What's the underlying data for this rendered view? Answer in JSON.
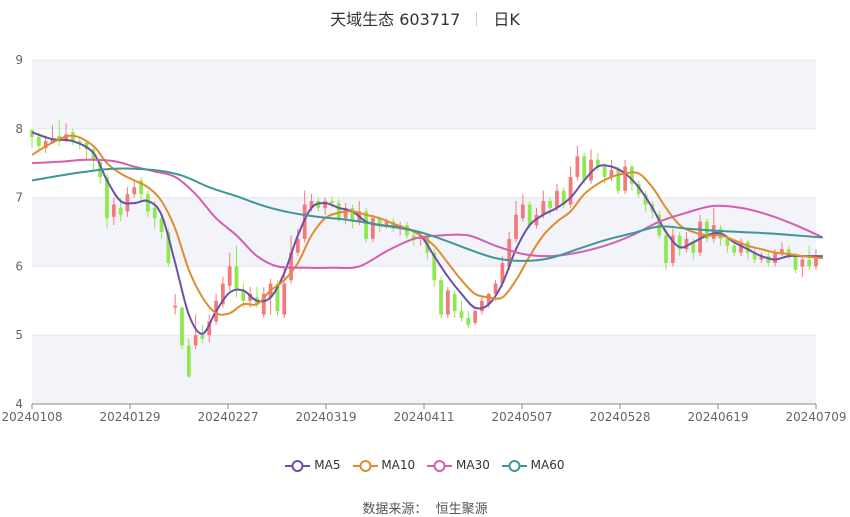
{
  "title": {
    "stock": "天域生态 603717",
    "period": "日K"
  },
  "source": {
    "label": "数据来源：",
    "value": "恒生聚源"
  },
  "colors": {
    "up": "#f47a7a",
    "down": "#8ee84e",
    "ma5": "#6e4fa8",
    "ma10": "#e08c32",
    "ma30": "#d45eb0",
    "ma60": "#3e9696",
    "band": "#f2f4fa",
    "grid": "#e6e8ef",
    "axis": "#8a8a8a"
  },
  "chart_data": {
    "type": "candlestick",
    "ylim": [
      4,
      9
    ],
    "yticks": [
      "4",
      "5",
      "6",
      "7",
      "8",
      "9"
    ],
    "xticks": [
      "20240108",
      "20240129",
      "20240227",
      "20240319",
      "20240411",
      "20240507",
      "20240528",
      "20240619",
      "20240709"
    ],
    "legend": [
      "MA5",
      "MA10",
      "MA30",
      "MA60"
    ],
    "legend_position": "bottom",
    "candles": [
      [
        7.98,
        7.88,
        8.0,
        7.72
      ],
      [
        7.88,
        7.75,
        7.95,
        7.68
      ],
      [
        7.72,
        7.82,
        7.9,
        7.65
      ],
      [
        7.8,
        7.86,
        8.05,
        7.78
      ],
      [
        7.9,
        7.82,
        8.12,
        7.75
      ],
      [
        7.84,
        7.92,
        8.08,
        7.8
      ],
      [
        7.95,
        7.82,
        8.0,
        7.76
      ],
      [
        7.82,
        7.78,
        7.88,
        7.7
      ],
      [
        7.8,
        7.7,
        7.84,
        7.55
      ],
      [
        7.7,
        7.56,
        7.74,
        7.4
      ],
      [
        7.52,
        7.3,
        7.56,
        7.2
      ],
      [
        7.3,
        6.7,
        7.34,
        6.55
      ],
      [
        6.72,
        6.9,
        7.0,
        6.6
      ],
      [
        6.85,
        6.75,
        7.0,
        6.65
      ],
      [
        6.8,
        7.05,
        7.15,
        6.72
      ],
      [
        7.05,
        7.15,
        7.25,
        7.0
      ],
      [
        7.25,
        7.05,
        7.3,
        6.95
      ],
      [
        7.05,
        6.8,
        7.1,
        6.72
      ],
      [
        6.85,
        6.7,
        6.95,
        6.55
      ],
      [
        6.7,
        6.5,
        6.75,
        6.4
      ],
      [
        6.5,
        6.05,
        6.55,
        6.0
      ],
      [
        5.4,
        5.43,
        5.6,
        5.3
      ],
      [
        5.4,
        4.85,
        5.42,
        4.8
      ],
      [
        4.85,
        4.4,
        4.95,
        4.38
      ],
      [
        4.85,
        5.0,
        5.3,
        4.8
      ],
      [
        5.0,
        4.95,
        5.15,
        4.88
      ],
      [
        5.0,
        5.2,
        5.3,
        4.9
      ],
      [
        5.2,
        5.5,
        5.6,
        5.15
      ],
      [
        5.45,
        5.75,
        5.85,
        5.4
      ],
      [
        5.72,
        6.0,
        6.2,
        5.65
      ],
      [
        6.0,
        5.65,
        6.3,
        5.55
      ],
      [
        5.65,
        5.5,
        5.75,
        5.4
      ],
      [
        5.5,
        5.6,
        5.7,
        5.4
      ],
      [
        5.55,
        5.45,
        5.7,
        5.4
      ],
      [
        5.3,
        5.6,
        5.7,
        5.25
      ],
      [
        5.55,
        5.75,
        5.82,
        5.3
      ],
      [
        5.75,
        5.35,
        5.8,
        5.28
      ],
      [
        5.3,
        5.75,
        6.0,
        5.25
      ],
      [
        5.8,
        6.2,
        6.45,
        5.75
      ],
      [
        6.2,
        6.4,
        6.55,
        6.15
      ],
      [
        6.4,
        6.9,
        7.1,
        6.35
      ],
      [
        6.85,
        6.95,
        7.05,
        6.8
      ],
      [
        6.95,
        6.85,
        7.0,
        6.8
      ],
      [
        6.85,
        6.95,
        7.0,
        6.75
      ],
      [
        6.95,
        6.92,
        7.02,
        6.85
      ],
      [
        6.92,
        6.7,
        6.98,
        6.65
      ],
      [
        6.7,
        6.85,
        6.92,
        6.62
      ],
      [
        6.85,
        6.65,
        6.9,
        6.55
      ],
      [
        6.65,
        6.8,
        6.95,
        6.6
      ],
      [
        6.8,
        6.4,
        6.85,
        6.35
      ],
      [
        6.4,
        6.7,
        6.75,
        6.35
      ],
      [
        6.7,
        6.6,
        6.72,
        6.5
      ],
      [
        6.6,
        6.65,
        6.7,
        6.55
      ],
      [
        6.65,
        6.55,
        6.7,
        6.5
      ],
      [
        6.55,
        6.6,
        6.65,
        6.45
      ],
      [
        6.6,
        6.45,
        6.65,
        6.4
      ],
      [
        6.45,
        6.4,
        6.5,
        6.3
      ],
      [
        6.4,
        6.45,
        6.5,
        6.3
      ],
      [
        6.45,
        6.2,
        6.48,
        6.1
      ],
      [
        6.2,
        5.8,
        6.25,
        5.7
      ],
      [
        5.8,
        5.3,
        5.85,
        5.25
      ],
      [
        5.3,
        5.65,
        5.7,
        5.25
      ],
      [
        5.6,
        5.35,
        5.65,
        5.25
      ],
      [
        5.35,
        5.25,
        5.5,
        5.2
      ],
      [
        5.25,
        5.15,
        5.35,
        5.1
      ],
      [
        5.18,
        5.35,
        5.4,
        5.15
      ],
      [
        5.35,
        5.5,
        5.55,
        5.3
      ],
      [
        5.45,
        5.6,
        5.62,
        5.4
      ],
      [
        5.6,
        5.75,
        5.8,
        5.5
      ],
      [
        5.75,
        6.05,
        6.15,
        5.7
      ],
      [
        6.0,
        6.4,
        6.5,
        5.95
      ],
      [
        6.4,
        6.75,
        6.95,
        6.35
      ],
      [
        6.7,
        6.9,
        7.05,
        6.65
      ],
      [
        6.9,
        6.6,
        6.95,
        6.55
      ],
      [
        6.6,
        6.75,
        6.85,
        6.55
      ],
      [
        6.75,
        6.95,
        7.1,
        6.7
      ],
      [
        6.95,
        6.85,
        7.0,
        6.75
      ],
      [
        6.85,
        7.1,
        7.2,
        6.8
      ],
      [
        7.1,
        6.9,
        7.15,
        6.85
      ],
      [
        6.9,
        7.3,
        7.45,
        6.85
      ],
      [
        7.3,
        7.6,
        7.75,
        7.25
      ],
      [
        7.6,
        7.25,
        7.65,
        7.2
      ],
      [
        7.25,
        7.55,
        7.7,
        7.2
      ],
      [
        7.55,
        7.45,
        7.65,
        7.4
      ],
      [
        7.45,
        7.3,
        7.5,
        7.2
      ],
      [
        7.3,
        7.4,
        7.55,
        7.25
      ],
      [
        7.4,
        7.1,
        7.45,
        7.05
      ],
      [
        7.1,
        7.45,
        7.55,
        7.05
      ],
      [
        7.45,
        7.2,
        7.48,
        7.1
      ],
      [
        7.2,
        7.05,
        7.25,
        7.0
      ],
      [
        7.05,
        6.9,
        7.1,
        6.8
      ],
      [
        6.9,
        6.8,
        6.95,
        6.7
      ],
      [
        6.75,
        6.45,
        6.8,
        6.4
      ],
      [
        6.45,
        6.05,
        6.55,
        5.95
      ],
      [
        6.05,
        6.45,
        6.55,
        6.0
      ],
      [
        6.45,
        6.25,
        6.5,
        6.15
      ],
      [
        6.25,
        6.4,
        6.5,
        6.2
      ],
      [
        6.35,
        6.2,
        6.4,
        6.1
      ],
      [
        6.2,
        6.65,
        6.75,
        6.15
      ],
      [
        6.65,
        6.4,
        6.7,
        6.35
      ],
      [
        6.4,
        6.6,
        6.85,
        6.35
      ],
      [
        6.55,
        6.4,
        6.6,
        6.3
      ],
      [
        6.4,
        6.3,
        6.45,
        6.2
      ],
      [
        6.3,
        6.2,
        6.35,
        6.15
      ],
      [
        6.2,
        6.35,
        6.4,
        6.15
      ],
      [
        6.35,
        6.2,
        6.38,
        6.1
      ],
      [
        6.2,
        6.1,
        6.25,
        6.05
      ],
      [
        6.1,
        6.15,
        6.2,
        6.05
      ],
      [
        6.15,
        6.05,
        6.2,
        6.0
      ],
      [
        6.05,
        6.2,
        6.25,
        6.0
      ],
      [
        6.2,
        6.25,
        6.35,
        6.15
      ],
      [
        6.25,
        6.15,
        6.3,
        6.1
      ],
      [
        6.15,
        5.95,
        6.2,
        5.9
      ],
      [
        6.0,
        6.1,
        6.15,
        5.85
      ],
      [
        6.1,
        6.0,
        6.3,
        5.95
      ],
      [
        6.0,
        6.15,
        6.25,
        5.95
      ]
    ],
    "ma": [
      {
        "name": "MA5",
        "color_key": "ma5",
        "points": [
          [
            0,
            7.95
          ],
          [
            3,
            7.85
          ],
          [
            6,
            7.82
          ],
          [
            9,
            7.65
          ],
          [
            11,
            7.25
          ],
          [
            13,
            6.95
          ],
          [
            15,
            6.92
          ],
          [
            17,
            6.95
          ],
          [
            19,
            6.75
          ],
          [
            21,
            6.05
          ],
          [
            23,
            5.3
          ],
          [
            25,
            5.02
          ],
          [
            27,
            5.35
          ],
          [
            29,
            5.62
          ],
          [
            31,
            5.65
          ],
          [
            33,
            5.5
          ],
          [
            35,
            5.55
          ],
          [
            37,
            5.9
          ],
          [
            39,
            6.45
          ],
          [
            41,
            6.85
          ],
          [
            43,
            6.92
          ],
          [
            45,
            6.85
          ],
          [
            47,
            6.8
          ],
          [
            49,
            6.65
          ],
          [
            51,
            6.6
          ],
          [
            53,
            6.58
          ],
          [
            55,
            6.55
          ],
          [
            57,
            6.45
          ],
          [
            59,
            6.15
          ],
          [
            61,
            5.85
          ],
          [
            63,
            5.6
          ],
          [
            65,
            5.4
          ],
          [
            67,
            5.45
          ],
          [
            69,
            5.75
          ],
          [
            71,
            6.25
          ],
          [
            73,
            6.6
          ],
          [
            75,
            6.75
          ],
          [
            77,
            6.85
          ],
          [
            79,
            7.0
          ],
          [
            81,
            7.25
          ],
          [
            83,
            7.45
          ],
          [
            85,
            7.45
          ],
          [
            87,
            7.35
          ],
          [
            89,
            7.15
          ],
          [
            91,
            6.85
          ],
          [
            93,
            6.5
          ],
          [
            95,
            6.28
          ],
          [
            97,
            6.35
          ],
          [
            99,
            6.45
          ],
          [
            101,
            6.48
          ],
          [
            103,
            6.35
          ],
          [
            105,
            6.25
          ],
          [
            107,
            6.15
          ],
          [
            109,
            6.1
          ],
          [
            111,
            6.15
          ],
          [
            113,
            6.15
          ],
          [
            116,
            6.15
          ]
        ]
      },
      {
        "name": "MA10",
        "color_key": "ma10",
        "points": [
          [
            0,
            7.62
          ],
          [
            3,
            7.8
          ],
          [
            6,
            7.9
          ],
          [
            9,
            7.75
          ],
          [
            11,
            7.5
          ],
          [
            13,
            7.35
          ],
          [
            15,
            7.25
          ],
          [
            17,
            7.15
          ],
          [
            19,
            6.95
          ],
          [
            21,
            6.55
          ],
          [
            23,
            5.95
          ],
          [
            25,
            5.55
          ],
          [
            27,
            5.32
          ],
          [
            29,
            5.32
          ],
          [
            31,
            5.45
          ],
          [
            33,
            5.45
          ],
          [
            35,
            5.65
          ],
          [
            37,
            5.8
          ],
          [
            39,
            6.05
          ],
          [
            41,
            6.45
          ],
          [
            43,
            6.7
          ],
          [
            45,
            6.78
          ],
          [
            47,
            6.8
          ],
          [
            49,
            6.75
          ],
          [
            51,
            6.7
          ],
          [
            53,
            6.62
          ],
          [
            55,
            6.55
          ],
          [
            57,
            6.45
          ],
          [
            59,
            6.3
          ],
          [
            61,
            6.05
          ],
          [
            63,
            5.8
          ],
          [
            65,
            5.6
          ],
          [
            67,
            5.55
          ],
          [
            69,
            5.55
          ],
          [
            71,
            5.8
          ],
          [
            73,
            6.15
          ],
          [
            75,
            6.45
          ],
          [
            77,
            6.65
          ],
          [
            79,
            6.8
          ],
          [
            81,
            7.05
          ],
          [
            83,
            7.2
          ],
          [
            85,
            7.3
          ],
          [
            87,
            7.35
          ],
          [
            89,
            7.35
          ],
          [
            91,
            7.15
          ],
          [
            93,
            6.85
          ],
          [
            95,
            6.6
          ],
          [
            97,
            6.5
          ],
          [
            99,
            6.45
          ],
          [
            101,
            6.45
          ],
          [
            103,
            6.38
          ],
          [
            105,
            6.3
          ],
          [
            107,
            6.25
          ],
          [
            109,
            6.2
          ],
          [
            111,
            6.18
          ],
          [
            113,
            6.15
          ],
          [
            116,
            6.12
          ]
        ]
      },
      {
        "name": "MA30",
        "color_key": "ma30",
        "points": [
          [
            0,
            7.5
          ],
          [
            4,
            7.52
          ],
          [
            8,
            7.55
          ],
          [
            12,
            7.53
          ],
          [
            15,
            7.45
          ],
          [
            18,
            7.38
          ],
          [
            21,
            7.3
          ],
          [
            24,
            7.05
          ],
          [
            27,
            6.7
          ],
          [
            30,
            6.45
          ],
          [
            33,
            6.15
          ],
          [
            36,
            6.0
          ],
          [
            40,
            5.98
          ],
          [
            44,
            5.98
          ],
          [
            48,
            6.0
          ],
          [
            52,
            6.22
          ],
          [
            56,
            6.4
          ],
          [
            60,
            6.45
          ],
          [
            64,
            6.45
          ],
          [
            68,
            6.3
          ],
          [
            72,
            6.18
          ],
          [
            76,
            6.15
          ],
          [
            80,
            6.2
          ],
          [
            84,
            6.3
          ],
          [
            88,
            6.45
          ],
          [
            92,
            6.65
          ],
          [
            96,
            6.78
          ],
          [
            100,
            6.88
          ],
          [
            104,
            6.85
          ],
          [
            108,
            6.75
          ],
          [
            112,
            6.6
          ],
          [
            116,
            6.42
          ]
        ]
      },
      {
        "name": "MA60",
        "color_key": "ma60",
        "points": [
          [
            0,
            7.25
          ],
          [
            6,
            7.35
          ],
          [
            12,
            7.42
          ],
          [
            18,
            7.4
          ],
          [
            22,
            7.32
          ],
          [
            26,
            7.15
          ],
          [
            30,
            7.02
          ],
          [
            34,
            6.88
          ],
          [
            38,
            6.78
          ],
          [
            42,
            6.72
          ],
          [
            46,
            6.68
          ],
          [
            50,
            6.62
          ],
          [
            56,
            6.52
          ],
          [
            60,
            6.4
          ],
          [
            64,
            6.25
          ],
          [
            68,
            6.12
          ],
          [
            72,
            6.08
          ],
          [
            76,
            6.12
          ],
          [
            80,
            6.25
          ],
          [
            84,
            6.38
          ],
          [
            88,
            6.48
          ],
          [
            92,
            6.58
          ],
          [
            96,
            6.55
          ],
          [
            100,
            6.52
          ],
          [
            104,
            6.5
          ],
          [
            108,
            6.48
          ],
          [
            112,
            6.45
          ],
          [
            116,
            6.42
          ]
        ]
      }
    ]
  }
}
